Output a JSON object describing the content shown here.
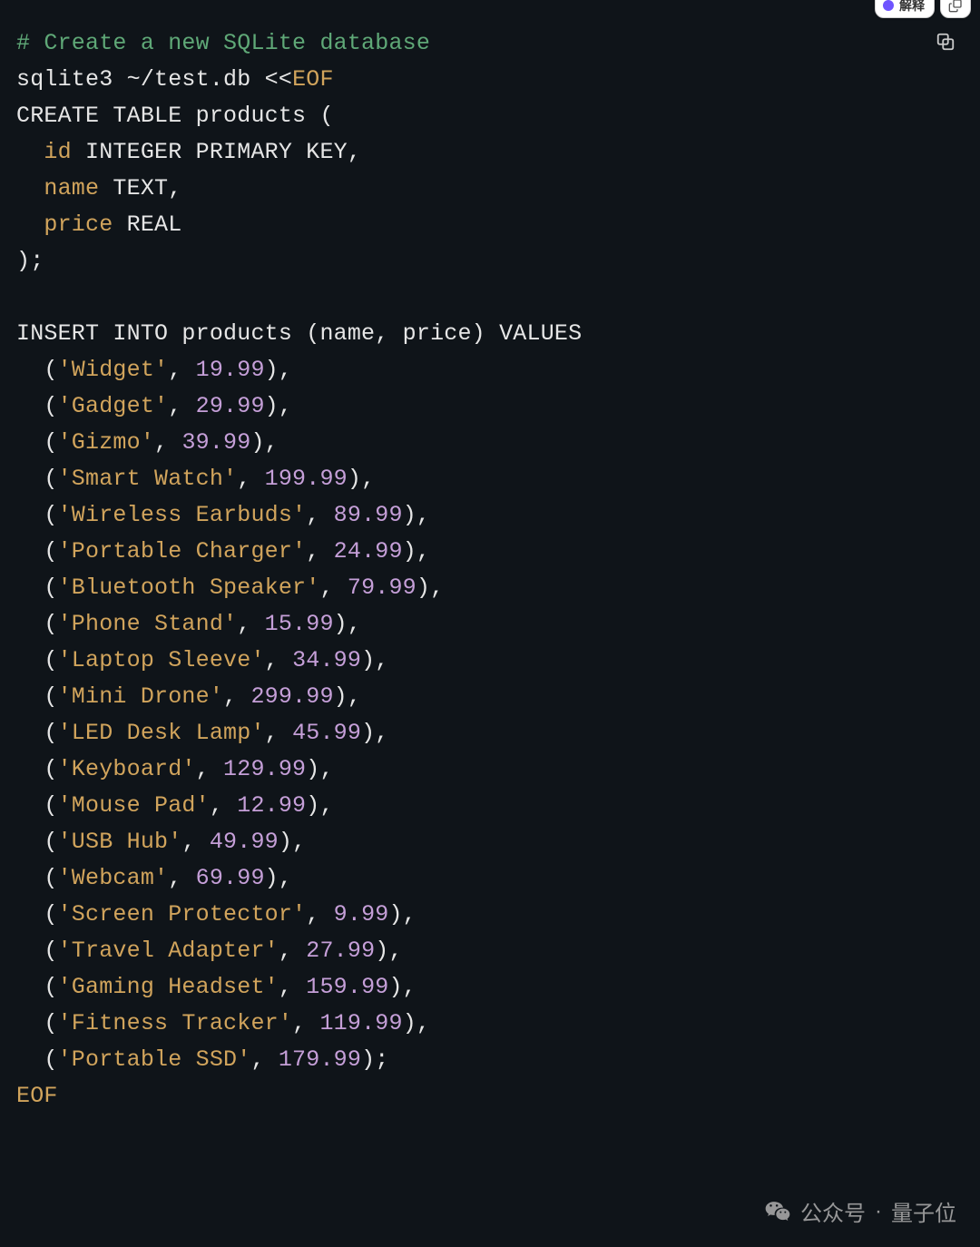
{
  "toolbar": {
    "action_label": "解释",
    "accent_color": "#6f54ff"
  },
  "code": {
    "comment": "# Create a new SQLite database",
    "cmd_prefix": "sqlite3 ~/test.db <<",
    "heredoc_open": "EOF",
    "create_line": "CREATE TABLE products (",
    "columns": [
      {
        "name": "id",
        "type_decl": " INTEGER PRIMARY KEY,"
      },
      {
        "name": "name",
        "type_decl": " TEXT,"
      },
      {
        "name": "price",
        "type_decl": " REAL"
      }
    ],
    "create_close": ");",
    "insert_line": "INSERT INTO products (name, price) VALUES",
    "rows": [
      {
        "name": "Widget",
        "price": "19.99",
        "tail": ","
      },
      {
        "name": "Gadget",
        "price": "29.99",
        "tail": ","
      },
      {
        "name": "Gizmo",
        "price": "39.99",
        "tail": ","
      },
      {
        "name": "Smart Watch",
        "price": "199.99",
        "tail": ","
      },
      {
        "name": "Wireless Earbuds",
        "price": "89.99",
        "tail": ","
      },
      {
        "name": "Portable Charger",
        "price": "24.99",
        "tail": ","
      },
      {
        "name": "Bluetooth Speaker",
        "price": "79.99",
        "tail": ","
      },
      {
        "name": "Phone Stand",
        "price": "15.99",
        "tail": ","
      },
      {
        "name": "Laptop Sleeve",
        "price": "34.99",
        "tail": ","
      },
      {
        "name": "Mini Drone",
        "price": "299.99",
        "tail": ","
      },
      {
        "name": "LED Desk Lamp",
        "price": "45.99",
        "tail": ","
      },
      {
        "name": "Keyboard",
        "price": "129.99",
        "tail": ","
      },
      {
        "name": "Mouse Pad",
        "price": "12.99",
        "tail": ","
      },
      {
        "name": "USB Hub",
        "price": "49.99",
        "tail": ","
      },
      {
        "name": "Webcam",
        "price": "69.99",
        "tail": ","
      },
      {
        "name": "Screen Protector",
        "price": "9.99",
        "tail": ","
      },
      {
        "name": "Travel Adapter",
        "price": "27.99",
        "tail": ","
      },
      {
        "name": "Gaming Headset",
        "price": "159.99",
        "tail": ","
      },
      {
        "name": "Fitness Tracker",
        "price": "119.99",
        "tail": ","
      },
      {
        "name": "Portable SSD",
        "price": "179.99",
        "tail": ";"
      }
    ],
    "heredoc_close": "EOF"
  },
  "watermark": {
    "prefix": "公众号",
    "separator": "·",
    "name": "量子位"
  }
}
